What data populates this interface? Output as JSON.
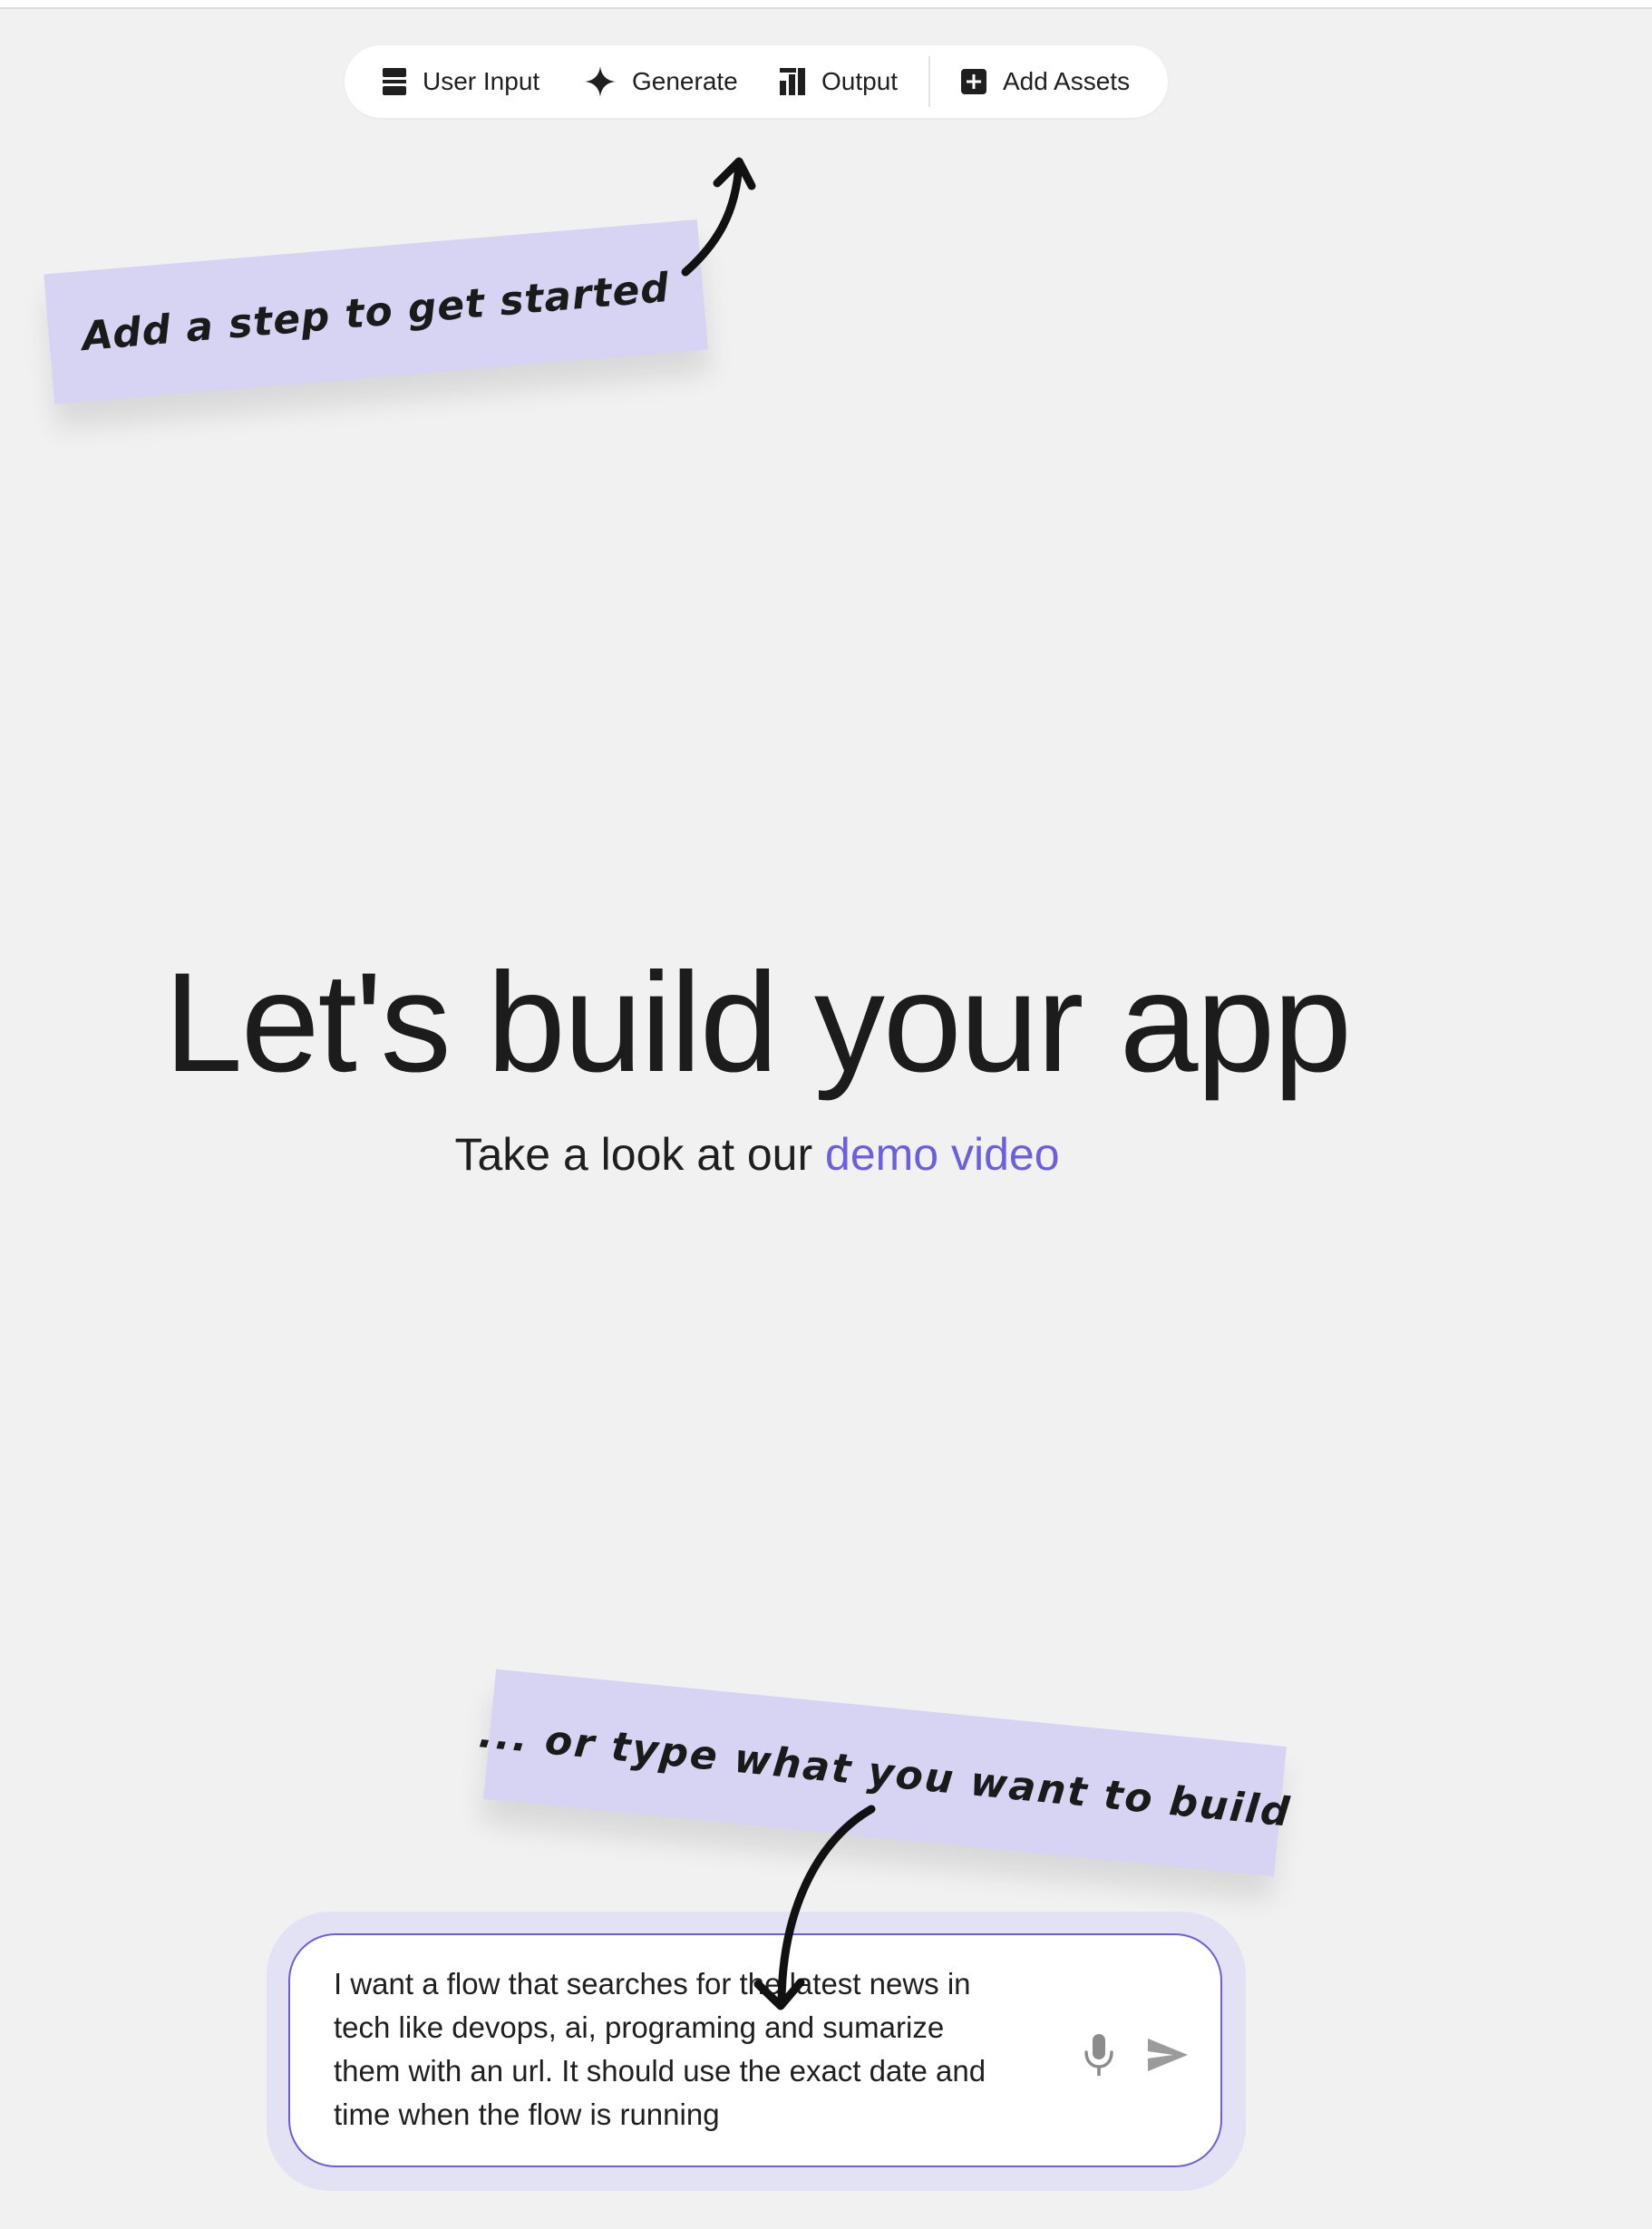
{
  "toolbar": {
    "user_input_label": "User Input",
    "generate_label": "Generate",
    "output_label": "Output",
    "add_assets_label": "Add Assets",
    "icons": [
      "user-input-icon",
      "sparkle-icon",
      "output-chart-icon",
      "add-box-icon"
    ]
  },
  "hints": {
    "add_step": "Add a step to get started",
    "type_build": "... or type what you want to build"
  },
  "hero": {
    "title": "Let's build your app",
    "subtitle_prefix": "Take a look at our ",
    "demo_link": "demo video"
  },
  "prompt": {
    "value": "I want a flow that searches for the latest news in\ntech like devops, ai, programing and sumarize\nthem with an url. It should use the exact date and\ntime when the flow is running",
    "icons": [
      "mic-icon",
      "send-icon"
    ]
  },
  "colors": {
    "background": "#f1f1f1",
    "accent": "#6b5ee0",
    "note": "#d6d3f3",
    "prompt_halo": "#e3e2f4"
  }
}
